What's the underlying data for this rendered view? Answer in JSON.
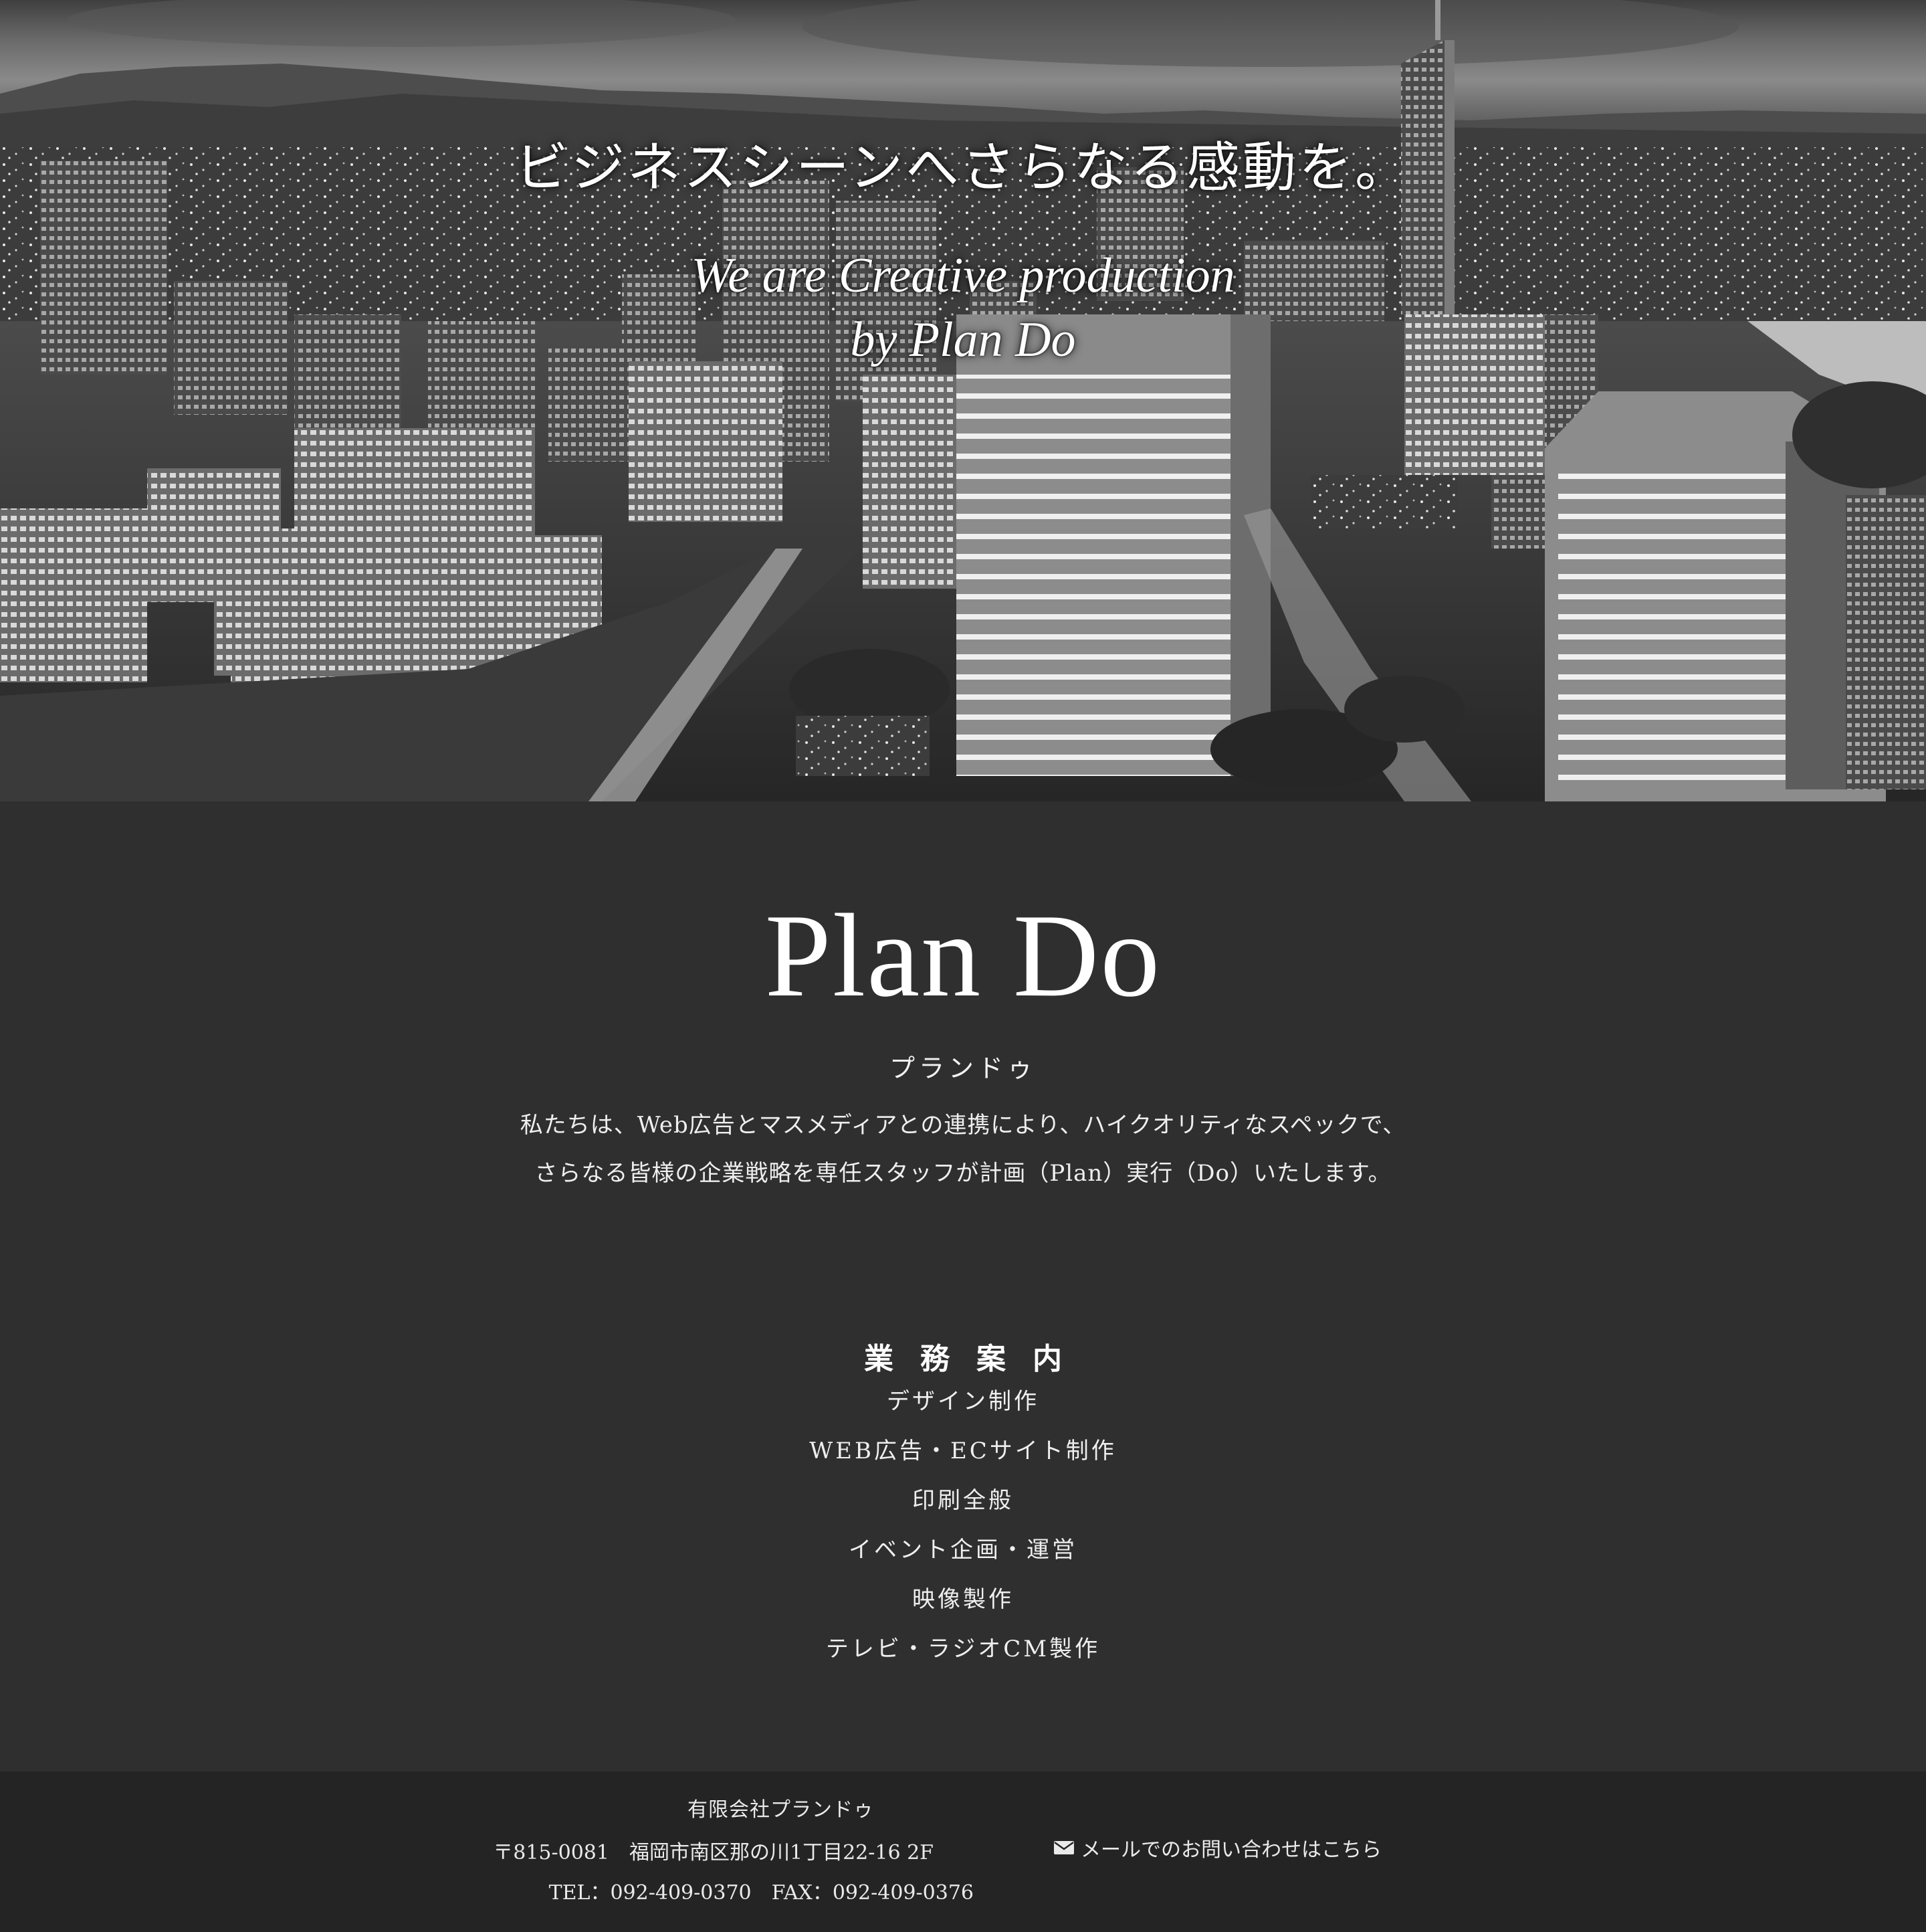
{
  "hero": {
    "headline": "ビジネスシーンへさらなる感動を。",
    "tagline_line1": "We are Creative production",
    "tagline_line2": "by Plan Do"
  },
  "about": {
    "logo_text": "Plan Do",
    "kana": "プランドゥ",
    "intro_line1": "私たちは、Web広告とマスメディアとの連携により、ハイクオリティなスペックで、",
    "intro_line2": "さらなる皆様の企業戦略を専任スタッフが計画（Plan）実行（Do）いたします。"
  },
  "services": {
    "title": "業務案内",
    "items": [
      "デザイン制作",
      "WEB広告・ECサイト制作",
      "印刷全般",
      "イベント企画・運営",
      "映像製作",
      "テレビ・ラジオCM製作"
    ]
  },
  "footer": {
    "company": "有限会社プランドゥ",
    "address": "〒815-0081　福岡市南区那の川1丁目22-16 2F",
    "phone": "TEL：092-409-0370　FAX：092-409-0376",
    "mail_link": "メールでのお問い合わせはこちら",
    "mail_icon": "envelope-icon"
  },
  "colors": {
    "background": "#2f2f2f",
    "footer_background": "#242424",
    "text": "#ffffff"
  }
}
